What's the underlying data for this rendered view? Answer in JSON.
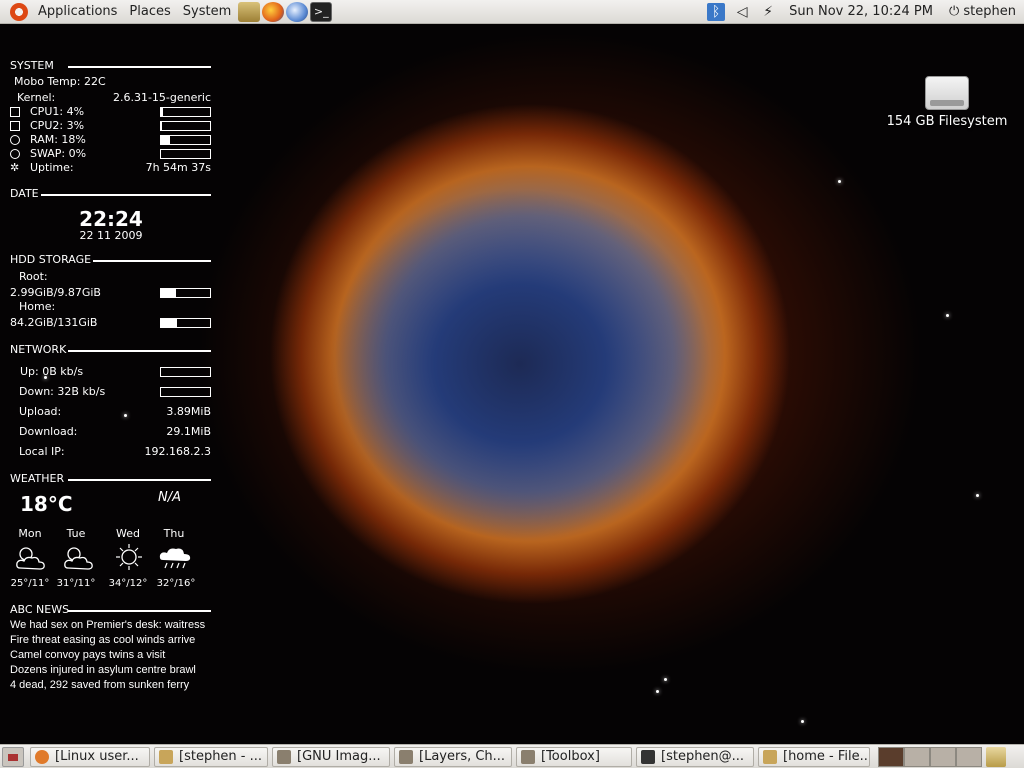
{
  "top_panel": {
    "menus": [
      "Applications",
      "Places",
      "System"
    ],
    "launchers": [
      "file-manager-icon",
      "firefox-icon",
      "thunderbird-icon",
      "terminal-icon"
    ],
    "tray_icons": [
      "bluetooth-icon",
      "volume-icon",
      "network-icon"
    ],
    "clock": "Sun Nov 22, 10:24 PM",
    "user": "stephen"
  },
  "conky": {
    "system": {
      "header": "SYSTEM",
      "mobo_temp": "Mobo Temp: 22C",
      "kernel_label": "Kernel:",
      "kernel_value": "2.6.31-15-generic",
      "cpu1": "CPU1: 4%",
      "cpu1_fraction": 0.04,
      "cpu2": "CPU2: 3%",
      "cpu2_fraction": 0.03,
      "ram": "RAM: 18%",
      "ram_fraction": 0.18,
      "swap": "SWAP: 0%",
      "swap_fraction": 0.0,
      "uptime_label": "Uptime:",
      "uptime_value": "7h 54m 37s"
    },
    "date": {
      "header": "DATE",
      "time": "22:24",
      "date": "22 11 2009"
    },
    "hdd": {
      "header": "HDD STORAGE",
      "root_label": "Root:",
      "root_value": "2.99GiB/9.87GiB",
      "root_fraction": 0.3,
      "home_label": "Home:",
      "home_value": "84.2GiB/131GiB",
      "home_fraction": 0.32
    },
    "network": {
      "header": "NETWORK",
      "up": "Up: 0B  kb/s",
      "up_fraction": 0.0,
      "down": "Down: 32B  kb/s",
      "down_fraction": 0.0,
      "upload_label": "Upload:",
      "upload_value": "3.89MiB",
      "download_label": "Download:",
      "download_value": "29.1MiB",
      "localip_label": "Local IP:",
      "localip_value": "192.168.2.3"
    },
    "weather": {
      "header": "WEATHER",
      "temp": "18°C",
      "wind": "N/A",
      "days": [
        {
          "name": "Mon",
          "range": "25°/11°",
          "icon": "partly-cloudy-icon"
        },
        {
          "name": "Tue",
          "range": "31°/11°",
          "icon": "partly-cloudy-icon"
        },
        {
          "name": "Wed",
          "range": "34°/12°",
          "icon": "sunny-icon"
        },
        {
          "name": "Thu",
          "range": "32°/16°",
          "icon": "storm-icon"
        }
      ]
    },
    "news": {
      "header": "ABC NEWS",
      "items": [
        "We had sex on Premier's desk: waitress",
        "Fire threat easing as cool winds arrive",
        "Camel convoy pays twins a visit",
        "Dozens injured in asylum centre brawl",
        "4 dead, 292 saved from sunken ferry"
      ]
    }
  },
  "desktop": {
    "drive_label": "154 GB Filesystem"
  },
  "taskbar": {
    "tasks": [
      {
        "label": "[Linux user...",
        "icon": "firefox-icon",
        "color": "#e07a2a"
      },
      {
        "label": "[stephen - ...",
        "icon": "folder-icon",
        "color": "#c8a55a"
      },
      {
        "label": "[GNU Imag...",
        "icon": "gimp-icon",
        "color": "#8a7f6e"
      },
      {
        "label": "[Layers, Ch...",
        "icon": "gimp-icon",
        "color": "#8a7f6e"
      },
      {
        "label": "[Toolbox]",
        "icon": "gimp-icon",
        "color": "#8a7f6e"
      },
      {
        "label": "[stephen@...",
        "icon": "terminal-icon",
        "color": "#333333"
      },
      {
        "label": "[home - File...",
        "icon": "folder-icon",
        "color": "#c8a55a"
      }
    ],
    "workspaces": 4,
    "active_workspace": 1
  },
  "colors": {
    "accent": "#dd4814",
    "panel": "#e6e4e0"
  }
}
